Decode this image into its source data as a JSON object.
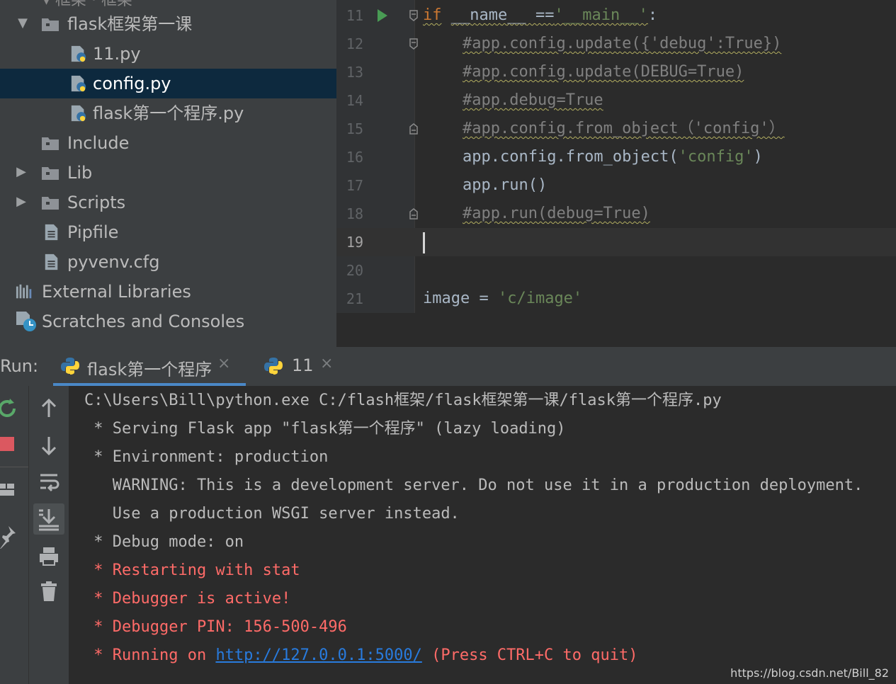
{
  "project_tree": {
    "top_partial": "▾ 框架 · 框架",
    "items": [
      {
        "label": "flask框架第一课",
        "type": "folder",
        "indent": 1,
        "expanded": true
      },
      {
        "label": "11.py",
        "type": "python-file",
        "indent": 2
      },
      {
        "label": "config.py",
        "type": "python-file",
        "indent": 2,
        "selected": true
      },
      {
        "label": "flask第一个程序.py",
        "type": "python-file",
        "indent": 2
      },
      {
        "label": "Include",
        "type": "folder",
        "indent": 1
      },
      {
        "label": "Lib",
        "type": "folder",
        "indent": 1,
        "collapsed": true
      },
      {
        "label": "Scripts",
        "type": "folder",
        "indent": 1,
        "collapsed": true
      },
      {
        "label": "Pipfile",
        "type": "text-file",
        "indent": 1
      },
      {
        "label": "pyvenv.cfg",
        "type": "text-file",
        "indent": 1
      },
      {
        "label": "External Libraries",
        "type": "libraries",
        "indent": 0
      },
      {
        "label": "Scratches and Consoles",
        "type": "scratches",
        "indent": 0
      }
    ]
  },
  "editor": {
    "current_line": "19",
    "lines": [
      {
        "num": "11"
      },
      {
        "num": "12"
      },
      {
        "num": "13"
      },
      {
        "num": "14"
      },
      {
        "num": "15"
      },
      {
        "num": "16"
      },
      {
        "num": "17"
      },
      {
        "num": "18"
      },
      {
        "num": "19"
      },
      {
        "num": "20"
      },
      {
        "num": "21"
      }
    ],
    "code": {
      "l11_kw": "if",
      "l11_name": "__name__",
      "l11_eq": " ==",
      "l11_str": "'__main__'",
      "l11_colon": ":",
      "l12": "#app.config.update({'debug':True})",
      "l13": "#app.config.update(DEBUG=True)",
      "l14": "#app.debug=True",
      "l15": "#app.config.from_object（'config'）",
      "l16_a": "app.config.from_object(",
      "l16_str": "'config'",
      "l16_b": ")",
      "l17": "app.run()",
      "l18": "#app.run(debug=True)",
      "l21_a": "image = ",
      "l21_str": "'c/image'"
    }
  },
  "run_panel": {
    "label": "Run:",
    "tabs": [
      {
        "label": "flask第一个程序",
        "close": "×",
        "active": true
      },
      {
        "label": "11",
        "close": "×",
        "active": false
      }
    ]
  },
  "console": {
    "lines": [
      {
        "text": "C:\\Users\\Bill\\python.exe C:/flash框架/flask框架第一课/flask第一个程序.py",
        "color": "normal"
      },
      {
        "text": " * Serving Flask app \"flask第一个程序\" (lazy loading)",
        "color": "normal"
      },
      {
        "text": " * Environment: production",
        "color": "normal"
      },
      {
        "text": "   WARNING: This is a development server. Do not use it in a production deployment.",
        "color": "normal"
      },
      {
        "text": "   Use a production WSGI server instead.",
        "color": "normal"
      },
      {
        "text": " * Debug mode: on",
        "color": "normal"
      },
      {
        "text": " * Restarting with stat",
        "color": "red"
      },
      {
        "text": " * Debugger is active!",
        "color": "red"
      },
      {
        "text": " * Debugger PIN: 156-500-496",
        "color": "red"
      }
    ],
    "last_prefix": " * Running on ",
    "last_link": "http://127.0.0.1:5000/",
    "last_suffix": " (Press CTRL+C to quit)"
  },
  "watermark": "https://blog.csdn.net/Bill_82",
  "colors": {
    "accent": "#4a88c7",
    "error": "#ff6b68",
    "keyword": "#cc7832",
    "string": "#6a8759",
    "comment": "#808080"
  },
  "side_icons": [
    "rerun-icon",
    "stop-icon",
    "layout-icon",
    "pin-icon",
    "up-arrow-icon",
    "down-arrow-icon",
    "soft-wrap-icon",
    "scroll-to-end-icon",
    "print-icon",
    "trash-icon"
  ]
}
